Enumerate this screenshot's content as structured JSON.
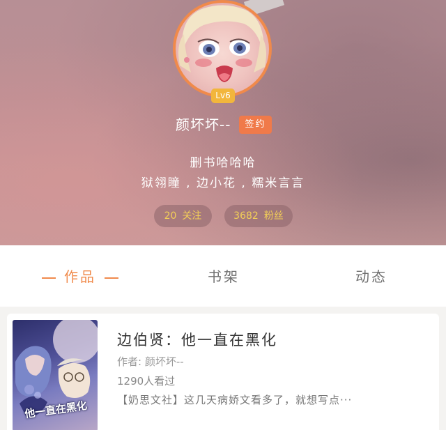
{
  "profile": {
    "level": "Lv6",
    "username": "颜坏坏--",
    "sign_badge": "签约",
    "bio_line1": "删书哈哈哈",
    "bio_line2": "狱翎瞳 , 边小花 , 糯米言言",
    "stats": {
      "following_count": "20",
      "following_label": "关注",
      "fans_count": "3682",
      "fans_label": "粉丝"
    }
  },
  "tabs": {
    "works": "作品",
    "bookshelf": "书架",
    "feed": "动态",
    "active": "works"
  },
  "books": [
    {
      "title": "边伯贤：他一直在黑化",
      "author": "作者: 颜坏坏--",
      "views": "1290人看过",
      "description": "【奶思文社】这几天病娇文看多了，就想写点···",
      "cover_text": "他一直在黑化"
    }
  ],
  "colors": {
    "accent": "#f08a4b",
    "level_badge": "#f2b63c",
    "stat_text": "#f3cf57"
  }
}
